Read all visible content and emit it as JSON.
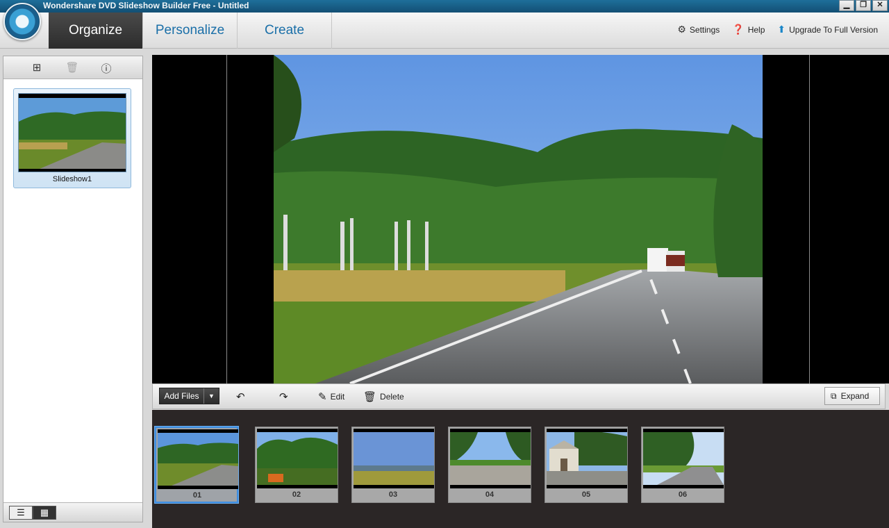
{
  "window": {
    "title": "Wondershare DVD Slideshow Builder Free - Untitled",
    "minimize": "▁",
    "maximize": "❐",
    "close": "✕"
  },
  "tabs": [
    {
      "label": "Organize",
      "active": true
    },
    {
      "label": "Personalize",
      "active": false
    },
    {
      "label": "Create",
      "active": false
    }
  ],
  "header_links": {
    "settings": {
      "label": "Settings",
      "icon": "gear-icon"
    },
    "help": {
      "label": "Help",
      "icon": "question-icon"
    },
    "upgrade": {
      "label": "Upgrade To Full Version",
      "icon": "upgrade-arrow-icon"
    }
  },
  "left_panel": {
    "tools": [
      {
        "icon": "add-slideshow-icon",
        "glyph": "⊞"
      },
      {
        "icon": "trash-icon",
        "glyph": "🗑"
      },
      {
        "icon": "info-icon",
        "glyph": "ⓘ"
      }
    ],
    "slideshow_label": "Slideshow1",
    "view_list_glyph": "☰",
    "view_grid_glyph": "▦"
  },
  "preview_toolbar": {
    "add_files": "Add Files",
    "dropdown_glyph": "▼",
    "rotate_left_glyph": "↶",
    "rotate_right_glyph": "↷",
    "edit": "Edit",
    "edit_glyph": "✎",
    "delete": "Delete",
    "delete_glyph": "🗑",
    "expand": "Expand",
    "expand_glyph": "⧉"
  },
  "timeline": {
    "frames": [
      {
        "number": "01",
        "selected": true,
        "scene": "road"
      },
      {
        "number": "02",
        "selected": false,
        "scene": "trees"
      },
      {
        "number": "03",
        "selected": false,
        "scene": "field"
      },
      {
        "number": "04",
        "selected": false,
        "scene": "path"
      },
      {
        "number": "05",
        "selected": false,
        "scene": "chapel"
      },
      {
        "number": "06",
        "selected": false,
        "scene": "lane"
      }
    ]
  }
}
